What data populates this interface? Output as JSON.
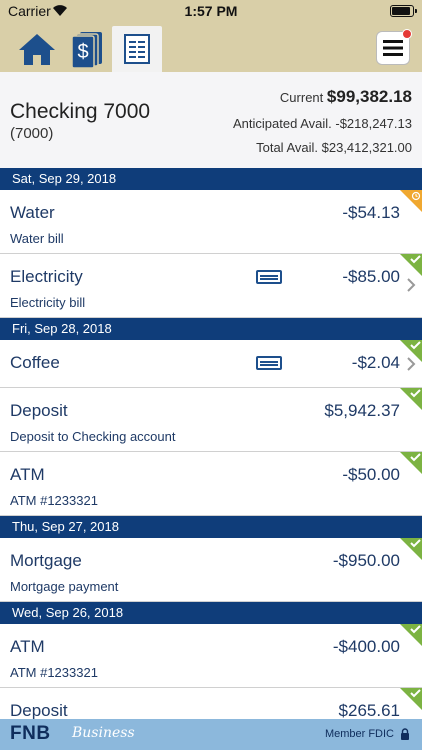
{
  "status_bar": {
    "carrier": "Carrier",
    "time": "1:57 PM",
    "battery_level": 0.9
  },
  "nav": {
    "tabs": [
      {
        "icon": "home-icon"
      },
      {
        "icon": "money-icon"
      },
      {
        "icon": "statement-icon",
        "active": true
      }
    ],
    "menu_icon": "hamburger-menu-icon"
  },
  "account": {
    "name": "Checking 7000",
    "number": "(7000)",
    "current_label": "Current",
    "current_value": "$99,382.18",
    "anticipated": "Anticipated Avail. -$218,247.13",
    "total": "Total Avail. $23,412,321.00"
  },
  "dates": [
    "Sat, Sep 29, 2018",
    "Fri, Sep 28, 2018",
    "Thu, Sep 27, 2018",
    "Wed, Sep 26, 2018"
  ],
  "transactions": [
    {
      "desc": "Water",
      "sub": "Water bill",
      "amount": "-$54.13",
      "status": "pending"
    },
    {
      "desc": "Electricity",
      "sub": "Electricity bill",
      "amount": "-$85.00",
      "status": "cleared"
    },
    {
      "desc": "Coffee",
      "sub": "",
      "amount": "-$2.04",
      "status": "cleared"
    },
    {
      "desc": "Deposit",
      "sub": "Deposit to Checking account",
      "amount": "$5,942.37",
      "status": "cleared"
    },
    {
      "desc": "ATM",
      "sub": "ATM #1233321",
      "amount": "-$50.00",
      "status": "cleared"
    },
    {
      "desc": "Mortgage",
      "sub": "Mortgage payment",
      "amount": "-$950.00",
      "status": "cleared"
    },
    {
      "desc": "ATM",
      "sub": "ATM #1233321",
      "amount": "-$400.00",
      "status": "cleared"
    },
    {
      "desc": "Deposit",
      "sub": "",
      "amount": "$265.61",
      "status": "cleared"
    }
  ],
  "footer": {
    "brand": "FNB",
    "brand_script": "Business",
    "member": "Member FDIC"
  },
  "colors": {
    "gold": "#d9cfa8",
    "navy": "#0f3d7a",
    "cleared": "#7cb342",
    "pending": "#f0a830",
    "footer": "#8cb8dc"
  }
}
